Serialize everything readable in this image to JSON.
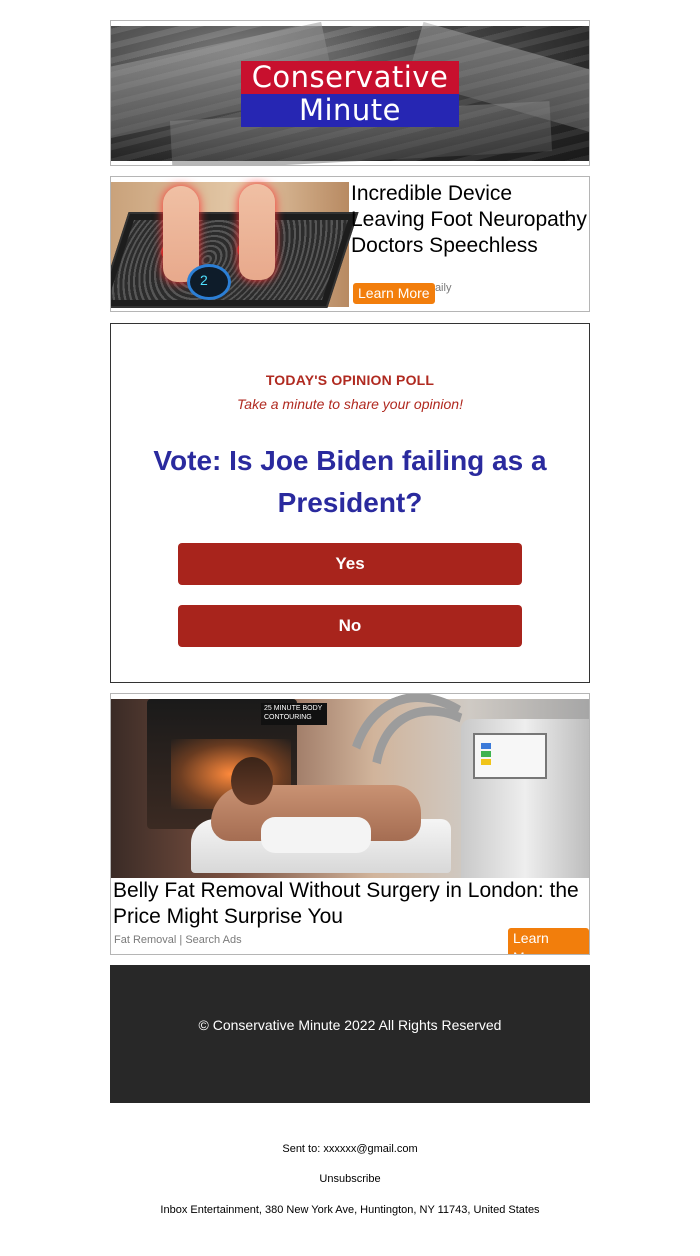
{
  "header": {
    "logo_line1": "Conservative",
    "logo_line2": "Minute"
  },
  "ad1": {
    "title": "Incredible Device Leaving Foot Neuropathy Doctors Speechless",
    "source": "Daily",
    "cta": "Learn More",
    "image_display": "2"
  },
  "poll": {
    "label": "TODAY'S OPINION POLL",
    "subtitle": "Take a minute to share your opinion!",
    "question": "Vote: Is Joe Biden failing as a President?",
    "options": [
      "Yes",
      "No"
    ]
  },
  "ad2": {
    "title": "Belly Fat Removal Without Surgery in London: the Price Might Surprise You",
    "source": "Fat Removal | Search Ads",
    "cta": "Learn More",
    "image_sign": "25 MINUTE BODY CONTOURING"
  },
  "footer": {
    "copyright": "© Conservative Minute 2022 All Rights Reserved"
  },
  "meta": {
    "sent_to": "Sent to: xxxxxx@gmail.com",
    "unsubscribe": "Unsubscribe",
    "address": "Inbox Entertainment, 380 New York Ave, Huntington, NY 11743, United States"
  },
  "colors": {
    "logo_red": "#c8102e",
    "logo_blue": "#2626b3",
    "poll_accent": "#b02a20",
    "poll_question": "#2a2a9e",
    "poll_button": "#a8241c",
    "cta_orange": "#f27e0c",
    "footer_bg": "#282828"
  }
}
